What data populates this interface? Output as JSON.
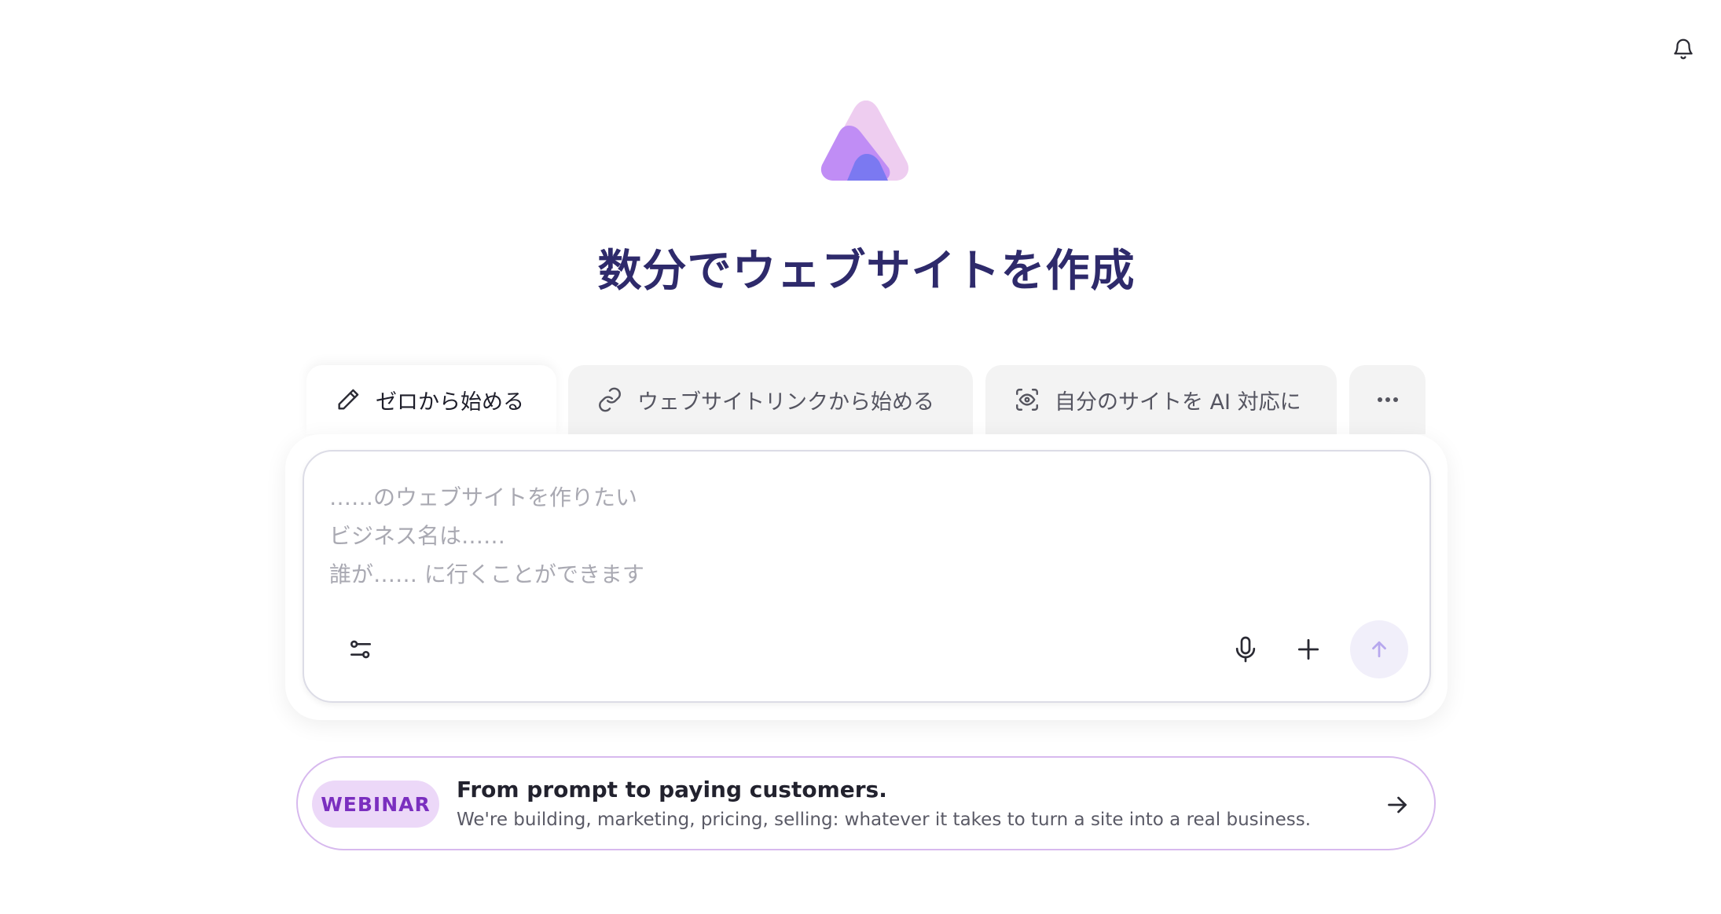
{
  "header": {
    "bell_icon": "bell-icon"
  },
  "brand": {
    "logo_icon": "logo-triangle-icon",
    "colors": {
      "light": "#eecdf0",
      "mid": "#c08df5",
      "deep": "#7b79f1"
    }
  },
  "hero": {
    "title": "数分でウェブサイトを作成"
  },
  "tabs": [
    {
      "label": "ゼロから始める",
      "icon": "pencil-icon",
      "active": true
    },
    {
      "label": "ウェブサイトリンクから始める",
      "icon": "link-icon",
      "active": false
    },
    {
      "label": "自分のサイトを AI 対応に",
      "icon": "scan-eye-icon",
      "active": false
    },
    {
      "label": "",
      "icon": "more-horizontal-icon",
      "active": false
    }
  ],
  "composer": {
    "placeholder": "……のウェブサイトを作りたい\nビジネス名は……\n誰が…… に行くことができます",
    "icons": {
      "filter": "sliders-icon",
      "mic": "microphone-icon",
      "plus": "plus-icon",
      "send": "arrow-up-icon"
    },
    "send_bg": "#f1effa"
  },
  "webinar": {
    "badge": "WEBINAR",
    "title": "From prompt to paying customers.",
    "subtitle": "We're building, marketing, pricing, selling: whatever it takes to turn a site into a real business.",
    "arrow_icon": "arrow-right-icon"
  }
}
